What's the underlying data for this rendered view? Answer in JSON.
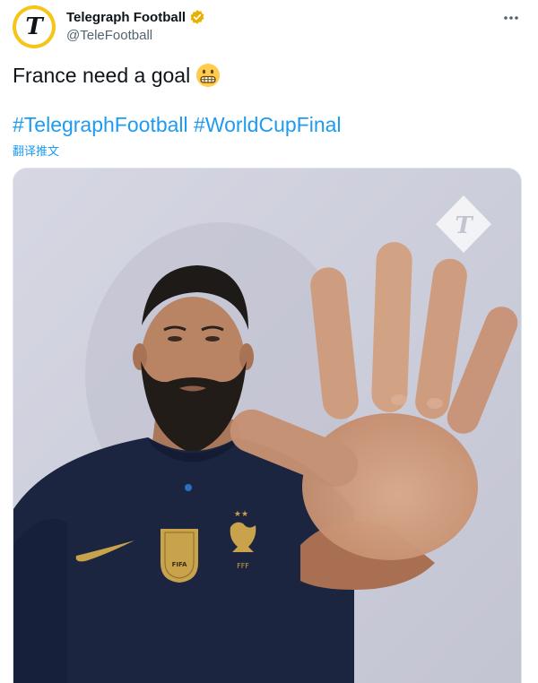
{
  "author": {
    "display_name": "Telegraph Football",
    "handle": "@TeleFootball",
    "avatar_letter": "T",
    "verified": true
  },
  "tweet": {
    "text": "France need a goal",
    "emoji": "grimacing-face",
    "hashtags": [
      "#TelegraphFootball",
      "#WorldCupFinal"
    ],
    "translate_label": "翻译推文"
  },
  "media": {
    "watermark_letter": "T",
    "badge_text": "FIFA",
    "crest_text": "FFF"
  },
  "colors": {
    "link": "#1d9bf0",
    "verified_badge": "#e8b100",
    "secondary_text": "#536471",
    "jersey": "#1b2540",
    "background": "#cfd0dc",
    "gold": "#c9a24c"
  }
}
